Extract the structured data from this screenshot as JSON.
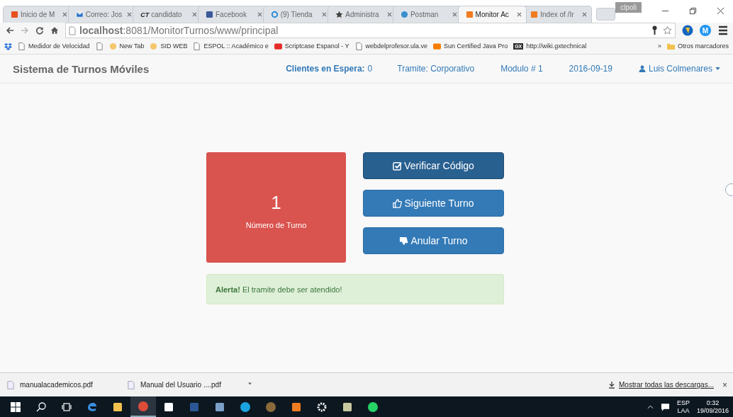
{
  "browser": {
    "tabs": [
      {
        "title": "Inicio de M",
        "favicon": {
          "kind": "square",
          "color": "#e8511e"
        },
        "selected": false
      },
      {
        "title": "Correo: Jos",
        "favicon": {
          "kind": "mail",
          "color": "#2a72c8"
        },
        "selected": false
      },
      {
        "title": "candidato",
        "favicon": {
          "kind": "text",
          "text": "CT",
          "color": "#222222"
        },
        "selected": false
      },
      {
        "title": "Facebook",
        "favicon": {
          "kind": "square",
          "color": "#3b5998"
        },
        "selected": false
      },
      {
        "title": "(9) Tienda",
        "favicon": {
          "kind": "ring",
          "color": "#2a8ad8"
        },
        "selected": false
      },
      {
        "title": "Administra",
        "favicon": {
          "kind": "star",
          "color": "#444444"
        },
        "selected": false
      },
      {
        "title": "Postman",
        "favicon": {
          "kind": "globe",
          "color": "#3a8fd0"
        },
        "selected": false
      },
      {
        "title": "Monitor Ac",
        "favicon": {
          "kind": "square",
          "color": "#f07c21"
        },
        "selected": true
      },
      {
        "title": "Index of /Ir",
        "favicon": {
          "kind": "square",
          "color": "#f07c21"
        },
        "selected": false
      }
    ],
    "profile": "clpoli",
    "url": "**localhost**:8081/MonitorTurnos/www/principal",
    "extension_letter": "M",
    "bookmarks": [
      {
        "kind": "dropbox"
      },
      {
        "kind": "page",
        "label": "Medidor de Velocidad"
      },
      {
        "kind": "page"
      },
      {
        "kind": "circle",
        "label": "New Tab"
      },
      {
        "kind": "circle",
        "label": "SID WEB"
      },
      {
        "kind": "page",
        "label": "ESPOL :: Académico e"
      },
      {
        "kind": "video",
        "label": "Scriptcase Espanol - Y"
      },
      {
        "kind": "page",
        "label": "webdelprofesor.ula.ve"
      },
      {
        "kind": "square",
        "label": "Sun Certified Java Pro"
      },
      {
        "kind": "text",
        "icon_text": "GX",
        "label": "http://wiki.gxtechnical"
      }
    ],
    "more": "»",
    "other_bookmarks": "Otros marcadores"
  },
  "navbar": {
    "brand": "Sistema de Turnos Móviles",
    "items": [
      {
        "kind": "text",
        "text": "**Clientes en Espera:** 0"
      },
      {
        "kind": "text",
        "text": "Tramite: Corporativo"
      },
      {
        "kind": "text",
        "text": "Modulo # 1"
      },
      {
        "kind": "text",
        "text": "2016-09-19"
      },
      {
        "kind": "user",
        "text": "Luis Colmenares"
      }
    ]
  },
  "turn_panel": {
    "number": "1",
    "label": "Número de Turno"
  },
  "actions": [
    {
      "label": "Verificar Código",
      "kind": "check",
      "selected": true
    },
    {
      "label": "Siguiente Turno",
      "kind": "like",
      "selected": false
    },
    {
      "label": "Anular Turno",
      "kind": "dislike",
      "selected": false
    }
  ],
  "alert": "**Alerta!** El tramite debe ser atendido!",
  "downloads": {
    "files": [
      "manualacademicos.pdf",
      "Manual del Usuario ....pdf"
    ],
    "show_all": "Mostrar todas las descargas...",
    "close": "×"
  },
  "taskbar": {
    "apps": [
      {
        "kind": "start",
        "selected": false
      },
      {
        "kind": "search",
        "selected": false
      },
      {
        "kind": "taskview",
        "selected": false
      },
      {
        "kind": "edge",
        "selected": false
      },
      {
        "kind": "folder",
        "selected": false
      },
      {
        "kind": "chrome",
        "selected": true
      },
      {
        "kind": "store",
        "selected": false
      },
      {
        "kind": "word",
        "selected": false
      },
      {
        "kind": "notes",
        "selected": false
      },
      {
        "kind": "skype",
        "selected": false
      },
      {
        "kind": "gear-brown",
        "selected": false
      },
      {
        "kind": "xampp",
        "selected": false
      },
      {
        "kind": "gear",
        "selected": false
      },
      {
        "kind": "paint",
        "selected": false
      },
      {
        "kind": "whatsapp",
        "selected": false
      }
    ],
    "language": "ESP",
    "layout": "LAA",
    "time": "0:32",
    "date": "19/09/2016"
  }
}
